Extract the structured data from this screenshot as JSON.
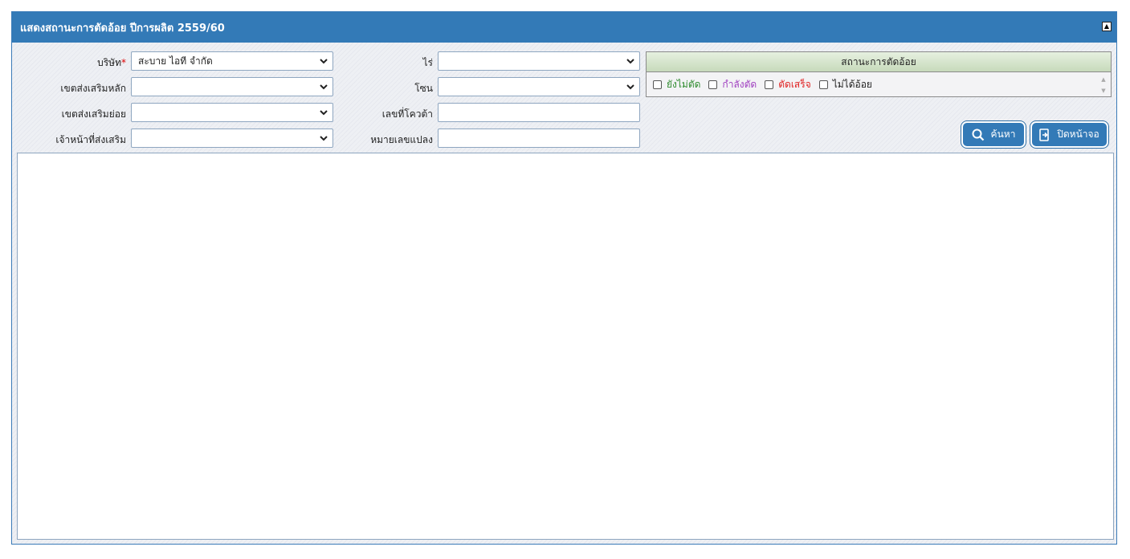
{
  "title": "แสดงสถานะการตัดอ้อย ปีการผลิต 2559/60",
  "form": {
    "company_label": "บริษัท",
    "company_required": "*",
    "company_value": "สะบาย ไอที จำกัด",
    "main_zone_label": "เขตส่งเสริมหลัก",
    "main_zone_value": "",
    "sub_zone_label": "เขตส่งเสริมย่อย",
    "sub_zone_value": "",
    "officer_label": "เจ้าหน้าที่ส่งเสริม",
    "officer_value": "",
    "farm_label": "ไร่",
    "farm_value": "",
    "zone_label": "โซน",
    "zone_value": "",
    "quota_label": "เลขที่โควต้า",
    "quota_value": "",
    "plot_label": "หมายเลขแปลง",
    "plot_value": ""
  },
  "status": {
    "header": "สถานะการตัดอ้อย",
    "options": [
      {
        "label": "ยังไม่ตัด",
        "color": "#2e8b2e"
      },
      {
        "label": "กำลังตัด",
        "color": "#a040c0"
      },
      {
        "label": "ตัดเสร็จ",
        "color": "#e02020"
      },
      {
        "label": "ไม่ได้อ้อย",
        "color": "#222222"
      }
    ]
  },
  "buttons": {
    "search_label": "ค้นหา",
    "close_label": "ปิดหน้าจอ"
  },
  "colors": {
    "accent": "#337ab7"
  }
}
